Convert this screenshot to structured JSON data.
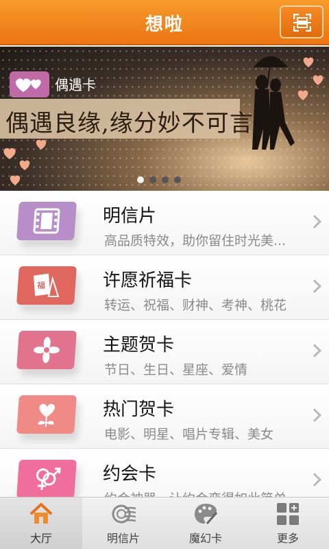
{
  "header": {
    "title": "想啦",
    "scan_icon": "scan-qr-icon"
  },
  "banner": {
    "tag_label": "偶遇卡",
    "slogan": "偶遇良缘,缘分妙不可言",
    "slide_count": 4,
    "active_slide": 1
  },
  "list": {
    "items": [
      {
        "title": "明信片",
        "subtitle": "高品质特效，助你留住时光美...",
        "icon": "filmstrip-icon",
        "color": "#b88ec9"
      },
      {
        "title": "许愿祈福卡",
        "subtitle": "转运、祝福、财神、考神、桃花",
        "icon": "blessing-card-icon",
        "color": "#e0675e"
      },
      {
        "title": "主题贺卡",
        "subtitle": "节日、生日、星座、爱情",
        "icon": "flower-icon",
        "color": "#e2738e"
      },
      {
        "title": "热门贺卡",
        "subtitle": "电影、明星、唱片专辑、美女",
        "icon": "heart-flower-icon",
        "color": "#f08a86"
      },
      {
        "title": "约会卡",
        "subtitle": "约会神器，让约会变得如此简单",
        "icon": "gender-symbol-icon",
        "color": "#ef6e9c"
      }
    ]
  },
  "tabbar": {
    "tabs": [
      {
        "label": "大厅",
        "icon": "home-icon",
        "active": true
      },
      {
        "label": "明信片",
        "icon": "postmark-icon",
        "active": false
      },
      {
        "label": "魔幻卡",
        "icon": "palette-icon",
        "active": false
      },
      {
        "label": "更多",
        "icon": "grid-more-icon",
        "active": false
      }
    ]
  },
  "colors": {
    "accent": "#f08a1e",
    "text_secondary": "#8a8a8a"
  }
}
